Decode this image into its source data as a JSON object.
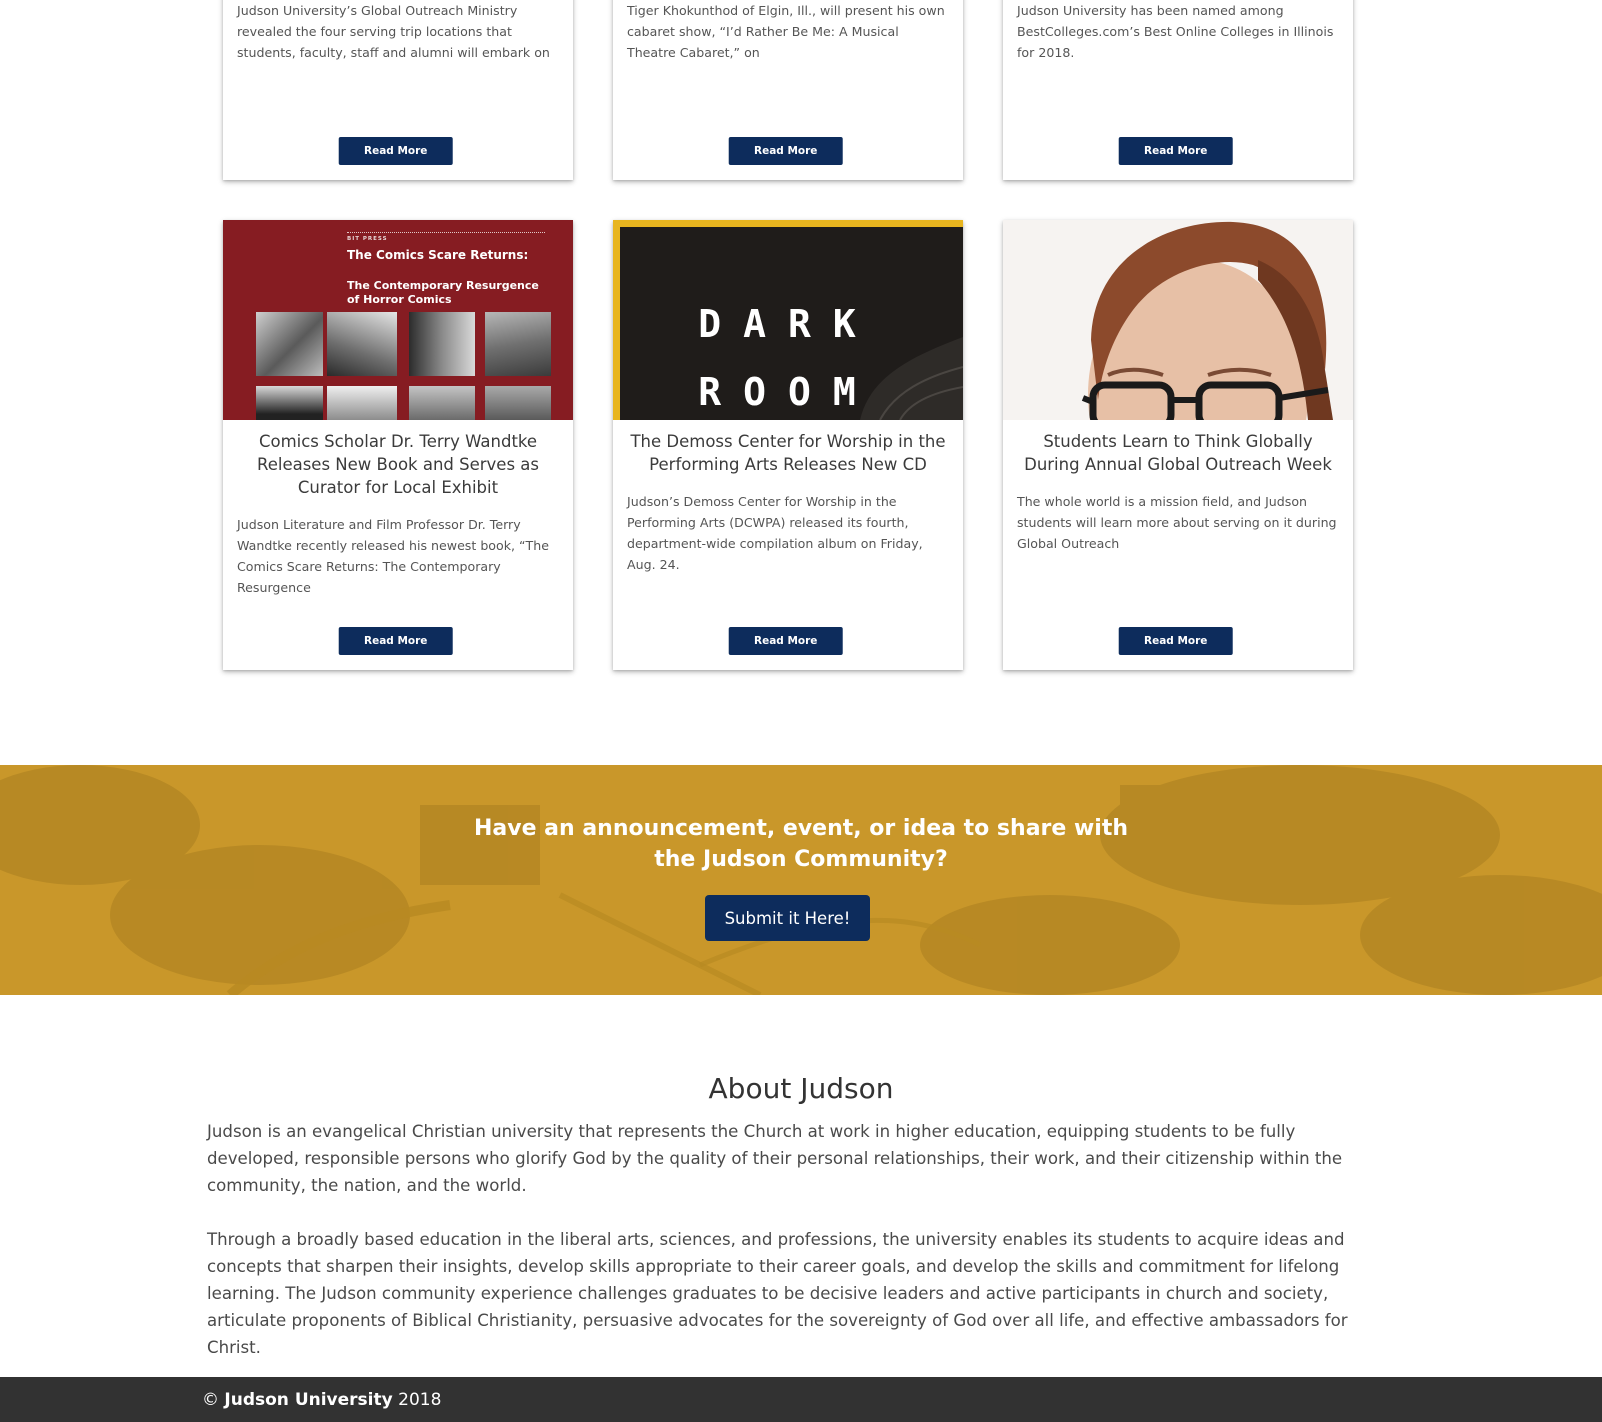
{
  "news_cards_top": [
    {
      "excerpt": "Judson University’s Global Outreach Ministry revealed the four serving trip locations that students, faculty, staff and alumni will embark on",
      "button": "Read More"
    },
    {
      "excerpt": "Tiger Khokunthod of Elgin, Ill., will present his own cabaret show, “I’d Rather Be Me: A Musical Theatre Cabaret,” on",
      "button": "Read More"
    },
    {
      "excerpt": "Judson University has been named among BestColleges.com’s Best Online Colleges in Illinois for 2018.",
      "button": "Read More"
    }
  ],
  "news_cards_bottom": [
    {
      "image": {
        "press": "BIT PRESS",
        "title": "The Comics Scare Returns:",
        "subtitle": "The Contemporary Resurgence of Horror Comics"
      },
      "title": "Comics Scholar Dr. Terry Wandtke Releases New Book and Serves as Curator for Local Exhibit",
      "excerpt": " Judson Literature and Film Professor Dr. Terry Wandtke recently released his newest book, “The Comics Scare Returns: The Contemporary Resurgence",
      "button": "Read More"
    },
    {
      "image": {
        "word1": "DARK",
        "word2": "ROOM"
      },
      "title": "The Demoss Center for Worship in the Performing Arts Releases New CD",
      "excerpt": "Judson’s Demoss Center for Worship in the Performing Arts (DCWPA) released its fourth, department-wide compilation album on Friday, Aug. 24.",
      "button": "Read More"
    },
    {
      "title": "Students Learn to Think Globally During Annual Global Outreach Week",
      "excerpt": " The whole world is a mission field, and Judson students will learn more about serving on it during Global Outreach",
      "button": "Read More"
    }
  ],
  "cta": {
    "heading": "Have an announcement, event, or idea to share with the Judson Community?",
    "button": "Submit it Here!",
    "color": "#c9972a"
  },
  "about": {
    "title": "About Judson",
    "p1": "Judson is an evangelical Christian university that represents the Church at work in higher education, equipping students to be fully developed, responsible persons who glorify God by the quality of their personal relationships, their work, and their citizenship within the community, the nation, and the world.",
    "p2": "Through a broadly based education in the liberal arts, sciences, and professions, the university enables its students to acquire ideas and concepts that sharpen their insights, develop skills appropriate to their career goals, and develop the skills and commitment for lifelong learning. The Judson community experience challenges graduates to be decisive leaders and active participants in church and society, articulate proponents of Biblical Christianity, persuasive advocates for the sovereignty of God over all life, and effective ambassadors for Christ."
  },
  "footer": {
    "copyright_symbol": "©",
    "org": "Judson University",
    "year": "2018"
  },
  "colors": {
    "button_navy": "#0d2c5c",
    "footer_bg": "#323232"
  }
}
